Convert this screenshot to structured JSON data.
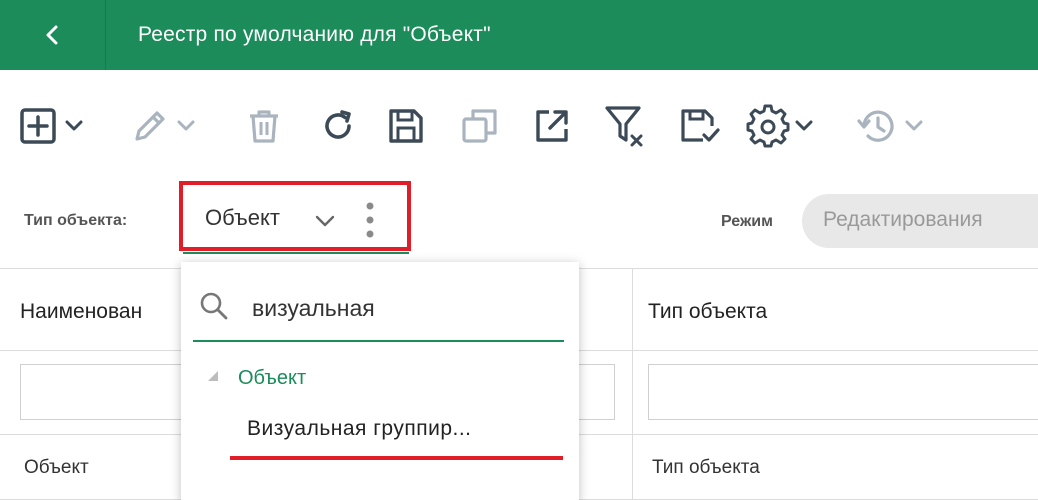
{
  "header": {
    "title": "Реестр по умолчанию для \"Объект\""
  },
  "toolbar": {
    "icons": [
      "add-icon",
      "edit-icon",
      "delete-icon",
      "refresh-icon",
      "save-icon",
      "copy-icon",
      "export-icon",
      "filter-clear-icon",
      "save-check-icon",
      "settings-icon",
      "history-icon"
    ]
  },
  "filter": {
    "type_label": "Тип объекта:",
    "type_value": "Объект",
    "mode_label": "Режим",
    "mode_value": "Редактирования"
  },
  "table": {
    "columns": [
      "Наименован",
      "Тип объекта"
    ],
    "rows": [
      [
        "Объект",
        "Тип объекта"
      ]
    ]
  },
  "dropdown": {
    "search_value": "визуальная",
    "group_label": "Объект",
    "item_label": "Визуальная группир..."
  },
  "colors": {
    "brand_green": "#1b8c5a",
    "highlight_red": "#e11d2a",
    "icon_dark": "#3c4a57",
    "icon_disabled": "#a9b4be"
  }
}
